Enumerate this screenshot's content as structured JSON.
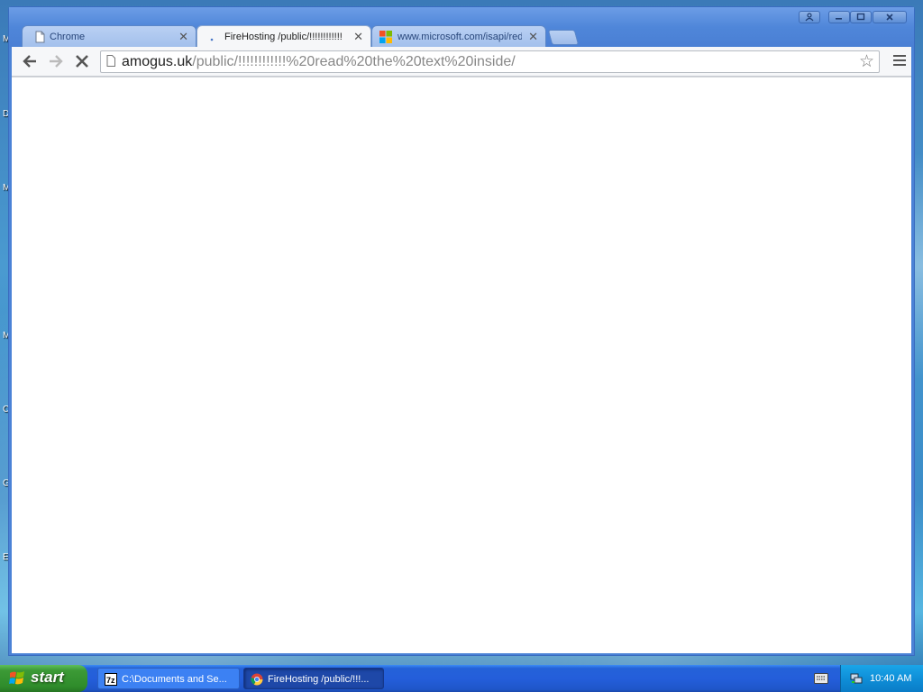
{
  "browser": {
    "tabs": [
      {
        "label": "Chrome",
        "icon": "page-icon",
        "active": false
      },
      {
        "label": "FireHosting /public/!!!!!!!!!!!!",
        "icon": "loading-icon",
        "active": true
      },
      {
        "label": "www.microsoft.com/isapi/red",
        "icon": "microsoft-icon",
        "active": false
      }
    ],
    "url_host": "amogus.uk",
    "url_path": "/public/!!!!!!!!!!!!%20read%20the%20text%20inside/",
    "window_buttons": [
      "user",
      "minimize",
      "maximize",
      "close"
    ]
  },
  "desktop": {
    "edge_letters": [
      "M",
      "D",
      "M",
      "M",
      "C",
      "G",
      "E"
    ]
  },
  "taskbar": {
    "start_label": "start",
    "tasks": [
      {
        "label": "C:\\Documents and Se...",
        "icon": "7zip-icon"
      },
      {
        "label": "FireHosting /public/!!!...",
        "icon": "chrome-icon"
      }
    ],
    "clock": "10:40 AM"
  },
  "colors": {
    "taskbar_blue": "#245edb",
    "start_green": "#3c9a36",
    "tray_blue": "#0f8fd8"
  }
}
